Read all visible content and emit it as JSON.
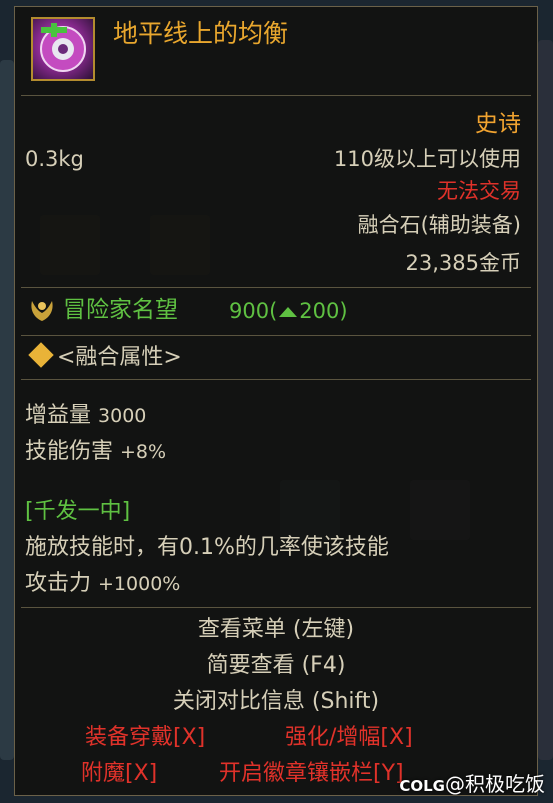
{
  "item": {
    "name": "地平线上的均衡",
    "rarity": "史诗",
    "weight": "0.3kg",
    "level_requirement": "110级以上可以使用",
    "trade_status": "无法交易",
    "type": "融合石(辅助装备)",
    "price": "23,385金币"
  },
  "fame": {
    "label": "冒险家名望",
    "value": "900(",
    "increase": "200)"
  },
  "fusion": {
    "section_title": "<融合属性>",
    "stats": [
      {
        "label": "增益量",
        "value": "3000"
      },
      {
        "label": "技能伤害",
        "value": "+8%"
      }
    ],
    "skill": {
      "title": "[千发一中]",
      "description": "施放技能时，有0.1%的几率使该技能",
      "attack_label": "攻击力",
      "attack_value": "+1000%"
    }
  },
  "help": {
    "view_menu": "查看菜单 (左键)",
    "quick_view": "简要查看 (F4)",
    "close_compare": "关闭对比信息 (Shift)"
  },
  "actions": {
    "equip": "装备穿戴[X]",
    "reinforce": "强化/增幅[X]",
    "enchant": "附魔[X]",
    "emblem": "开启徽章镶嵌栏[Y]"
  },
  "watermark": {
    "logo": "COLG",
    "text": "@积极吃饭"
  },
  "colors": {
    "rarity": "#f2a430",
    "fame": "#5fc142",
    "untradeable": "#e0322a",
    "title": "#e9a72e"
  },
  "icons": {
    "item": "fusion-stone-icon",
    "fame": "laurel-icon",
    "section": "diamond-icon",
    "fame_up": "up-arrow-icon"
  }
}
